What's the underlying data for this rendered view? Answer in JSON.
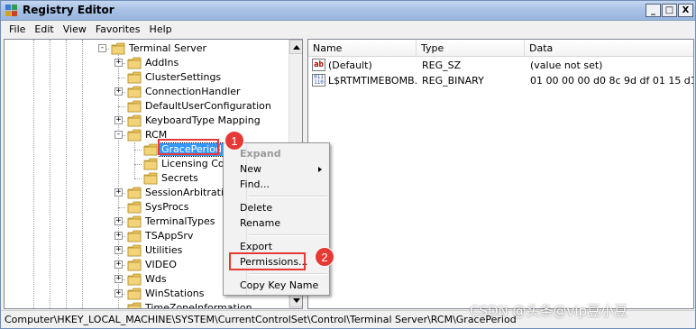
{
  "window": {
    "title": "Registry Editor",
    "controls": {
      "minimize": "_",
      "maximize": "□",
      "close": "X"
    }
  },
  "menubar": [
    "File",
    "Edit",
    "View",
    "Favorites",
    "Help"
  ],
  "tree": {
    "nodes": [
      {
        "label": "Terminal Server",
        "expander": "-"
      },
      {
        "label": "AddIns",
        "expander": "+"
      },
      {
        "label": "ClusterSettings",
        "expander": ""
      },
      {
        "label": "ConnectionHandler",
        "expander": "+"
      },
      {
        "label": "DefaultUserConfiguration",
        "expander": ""
      },
      {
        "label": "KeyboardType Mapping",
        "expander": "+"
      },
      {
        "label": "RCM",
        "expander": "-"
      },
      {
        "label": "GracePeriod",
        "expander": "",
        "selected": true
      },
      {
        "label": "Licensing Cor",
        "expander": ""
      },
      {
        "label": "Secrets",
        "expander": ""
      },
      {
        "label": "SessionArbitration",
        "expander": "+"
      },
      {
        "label": "SysProcs",
        "expander": ""
      },
      {
        "label": "TerminalTypes",
        "expander": "+"
      },
      {
        "label": "TSAppSrv",
        "expander": "+"
      },
      {
        "label": "Utilities",
        "expander": "+"
      },
      {
        "label": "VIDEO",
        "expander": "+"
      },
      {
        "label": "Wds",
        "expander": "+"
      },
      {
        "label": "WinStations",
        "expander": "+"
      },
      {
        "label": "TimeZoneInformation",
        "expander": ""
      }
    ]
  },
  "list": {
    "columns": [
      "Name",
      "Type",
      "Data"
    ],
    "rows": [
      {
        "icon": "string-value-icon",
        "name": "(Default)",
        "type": "REG_SZ",
        "data": "(value not set)"
      },
      {
        "icon": "binary-value-icon",
        "name": "L$RTMTIMEBOMB...",
        "type": "REG_BINARY",
        "data": "01 00 00 00 d0 8c 9d df 01 15 d1 11 8"
      }
    ]
  },
  "context_menu": {
    "items": [
      {
        "label": "Expand",
        "disabled": true
      },
      {
        "label": "New",
        "submenu": true
      },
      {
        "label": "Find..."
      },
      {
        "separator": true
      },
      {
        "label": "Delete"
      },
      {
        "label": "Rename"
      },
      {
        "separator": true
      },
      {
        "label": "Export"
      },
      {
        "label": "Permissions...",
        "highlighted": true
      },
      {
        "separator": true
      },
      {
        "label": "Copy Key Name"
      }
    ]
  },
  "annotations": {
    "step1": "1",
    "step2": "2",
    "color": "#e53935"
  },
  "statusbar": {
    "path": "Computer\\HKEY_LOCAL_MACHINE\\SYSTEM\\CurrentControlSet\\Control\\Terminal Server\\RCM\\GracePeriod"
  },
  "watermark": "CSDN @头条@vip豆小豆",
  "colors": {
    "selection": "#3399ff",
    "folder": "#e8c25a",
    "titlebar": "#a9c2e6"
  }
}
